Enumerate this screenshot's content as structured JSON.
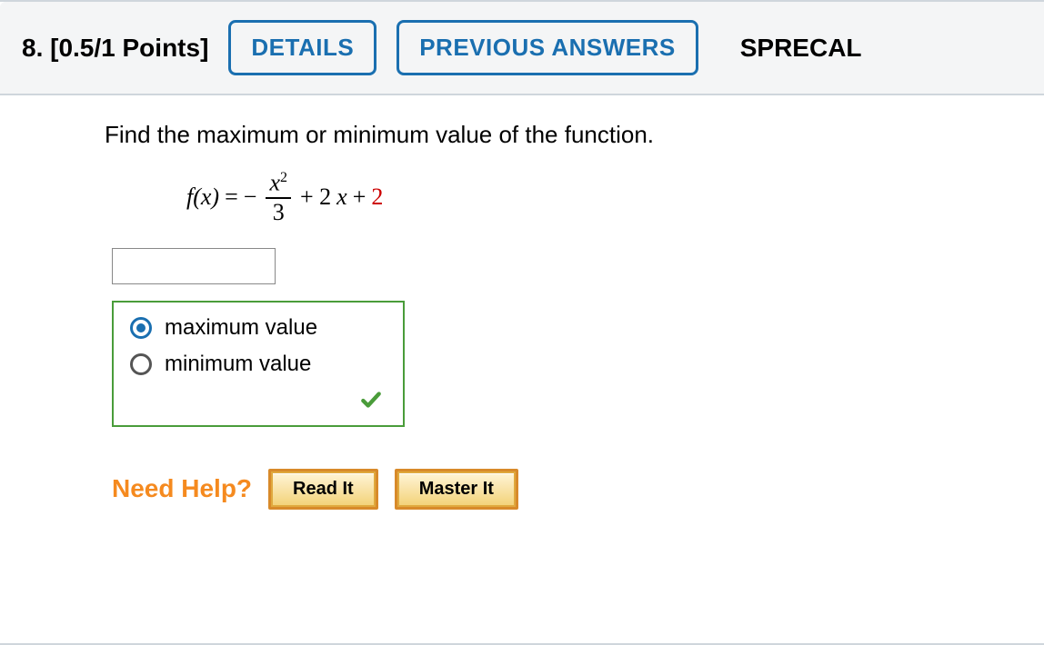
{
  "header": {
    "question_label": "8.  [0.5/1 Points]",
    "details_button": "DETAILS",
    "previous_answers_button": "PREVIOUS ANSWERS",
    "reference": "SPRECAL"
  },
  "prompt": "Find the maximum or minimum value of the function.",
  "equation": {
    "lhs": "f(x)",
    "eq": "=",
    "neg": "−",
    "frac_num_var": "x",
    "frac_num_power": "2",
    "frac_den": "3",
    "plus1": "+ 2",
    "xvar": "x",
    "plus2": "+",
    "constant": "2"
  },
  "answer_input": "",
  "options": {
    "maximum": "maximum value",
    "minimum": "minimum value",
    "selected": "maximum",
    "correct": true
  },
  "help": {
    "label": "Need Help?",
    "read_it": "Read It",
    "master_it": "Master It"
  }
}
